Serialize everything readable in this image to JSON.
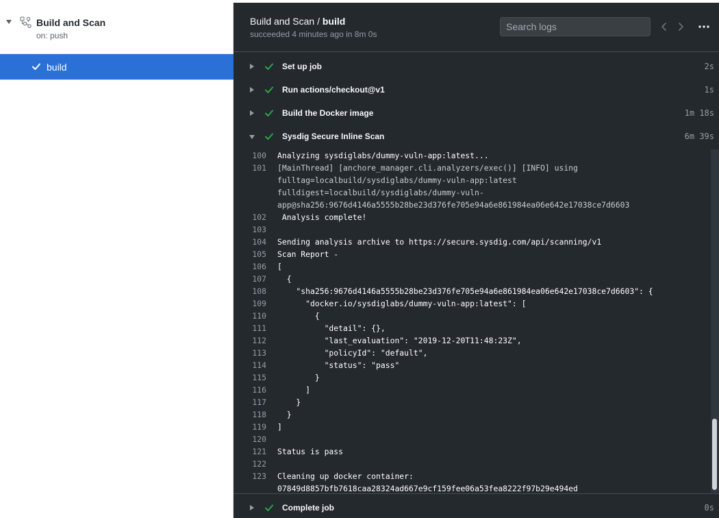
{
  "sidebar": {
    "workflow_title": "Build and Scan",
    "workflow_trigger": "on: push",
    "jobs": [
      {
        "label": "build",
        "status": "success",
        "selected": true
      }
    ]
  },
  "panel": {
    "workflow_name": "Build and Scan",
    "separator": " / ",
    "job_name": "build",
    "status_line": "succeeded 4 minutes ago in 8m 0s",
    "search_placeholder": "Search logs"
  },
  "steps": [
    {
      "name": "Set up job",
      "duration": "2s",
      "expanded": false
    },
    {
      "name": "Run actions/checkout@v1",
      "duration": "1s",
      "expanded": false
    },
    {
      "name": "Build the Docker image",
      "duration": "1m 18s",
      "expanded": false
    },
    {
      "name": "Sysdig Secure Inline Scan",
      "duration": "6m 39s",
      "expanded": true
    },
    {
      "name": "Complete job",
      "duration": "0s",
      "expanded": false
    }
  ],
  "log_lines": [
    {
      "no": "100",
      "text": "Analyzing sysdiglabs/dummy-vuln-app:latest..."
    },
    {
      "no": "101",
      "text": "[MainThread] [anchore_manager.cli.analyzers/exec()] [INFO] using",
      "dim": true
    },
    {
      "no": "",
      "text": "fulltag=localbuild/sysdiglabs/dummy-vuln-app:latest",
      "dim": true
    },
    {
      "no": "",
      "text": "fulldigest=localbuild/sysdiglabs/dummy-vuln-",
      "dim": true
    },
    {
      "no": "",
      "text": "app@sha256:9676d4146a5555b28be23d376fe705e94a6e861984ea06e642e17038ce7d6603",
      "dim": true
    },
    {
      "no": "102",
      "text": " Analysis complete!"
    },
    {
      "no": "103",
      "text": ""
    },
    {
      "no": "104",
      "text": "Sending analysis archive to https://secure.sysdig.com/api/scanning/v1"
    },
    {
      "no": "105",
      "text": "Scan Report -"
    },
    {
      "no": "106",
      "text": "["
    },
    {
      "no": "107",
      "text": "  {"
    },
    {
      "no": "108",
      "text": "    \"sha256:9676d4146a5555b28be23d376fe705e94a6e861984ea06e642e17038ce7d6603\": {"
    },
    {
      "no": "109",
      "text": "      \"docker.io/sysdiglabs/dummy-vuln-app:latest\": ["
    },
    {
      "no": "110",
      "text": "        {"
    },
    {
      "no": "111",
      "text": "          \"detail\": {},"
    },
    {
      "no": "112",
      "text": "          \"last_evaluation\": \"2019-12-20T11:48:23Z\","
    },
    {
      "no": "113",
      "text": "          \"policyId\": \"default\","
    },
    {
      "no": "114",
      "text": "          \"status\": \"pass\""
    },
    {
      "no": "115",
      "text": "        }"
    },
    {
      "no": "116",
      "text": "      ]"
    },
    {
      "no": "117",
      "text": "    }"
    },
    {
      "no": "118",
      "text": "  }"
    },
    {
      "no": "119",
      "text": "]"
    },
    {
      "no": "120",
      "text": ""
    },
    {
      "no": "121",
      "text": "Status is pass"
    },
    {
      "no": "122",
      "text": ""
    },
    {
      "no": "123",
      "text": "Cleaning up docker container:"
    },
    {
      "no": "",
      "text": "07849d8857bfb7618caa28324ad667e9cf159fee06a53fea8222f97b29e494ed"
    }
  ],
  "colors": {
    "accent": "#2a70d6",
    "success": "#28a745",
    "panel_bg": "#24292e"
  },
  "icons": {
    "workflow": "workflow-graph-icon",
    "check": "check-icon",
    "prev": "chevron-left-icon",
    "next": "chevron-right-icon",
    "more": "kebab-horizontal-icon"
  }
}
